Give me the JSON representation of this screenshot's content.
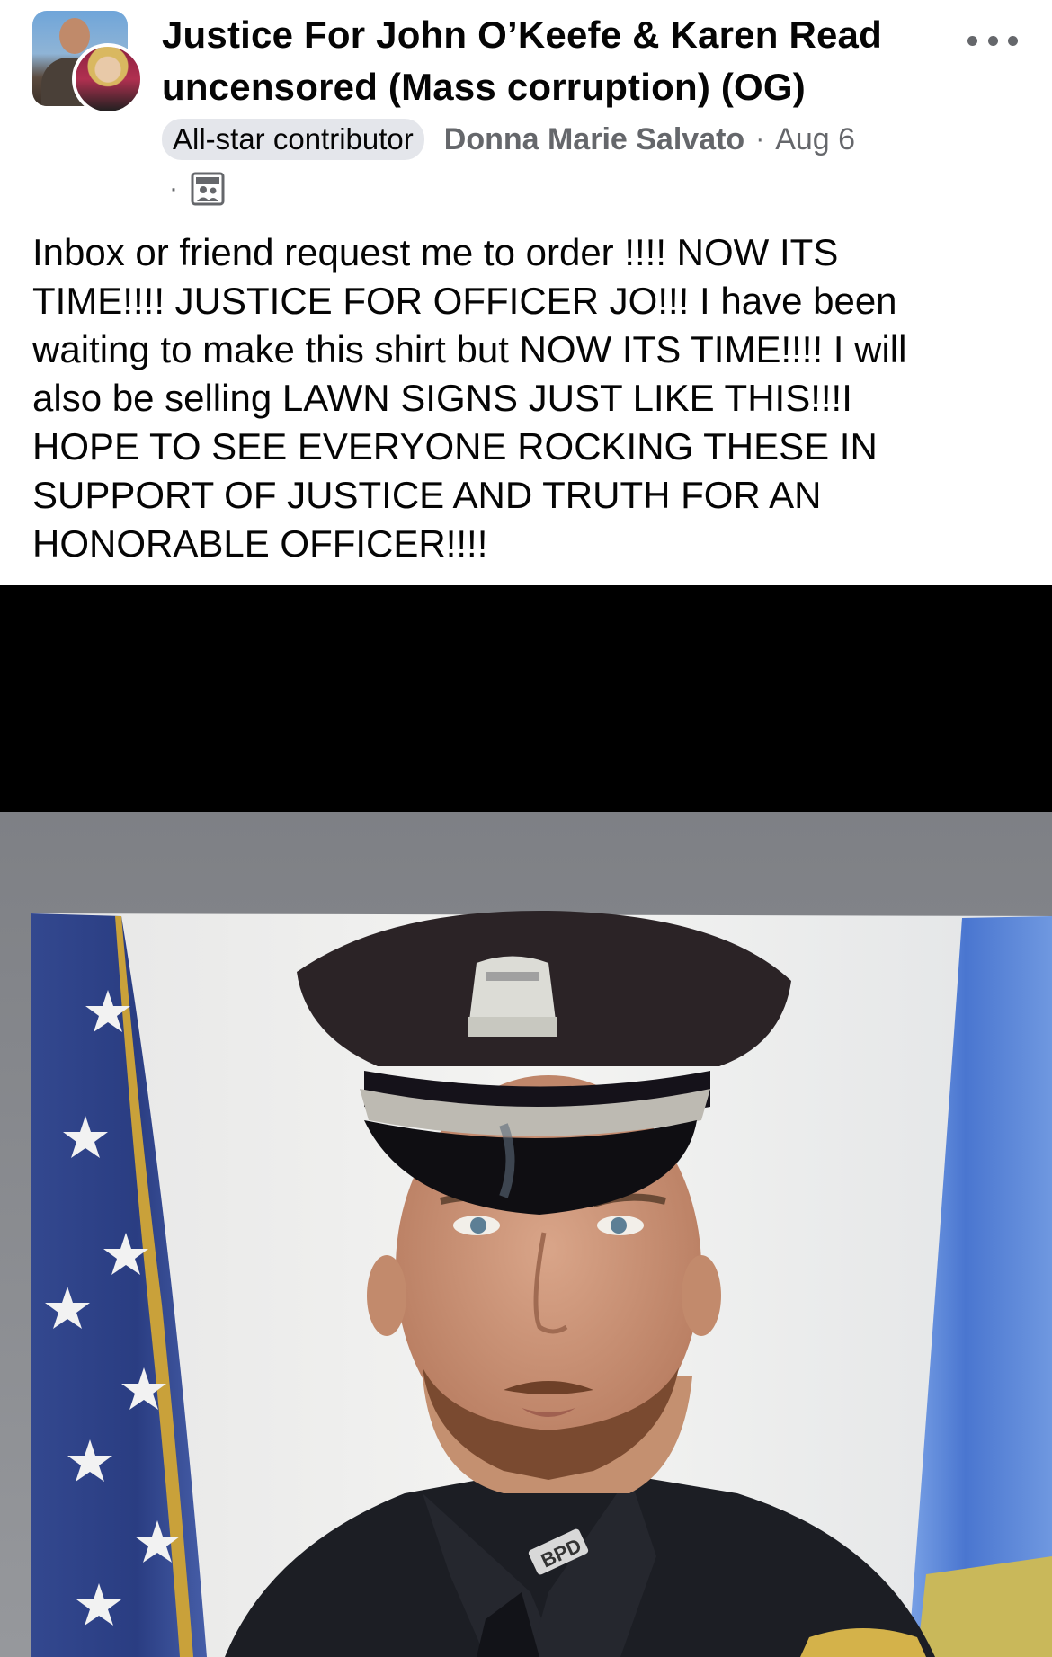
{
  "post": {
    "group_name_line1": "Justice For John O’Keefe & Karen Read",
    "group_name_line2": "uncensored (Mass corruption) (OG)",
    "badge": "All-star contributor",
    "author": "Donna Marie Salvato",
    "separator": "·",
    "date": "Aug 6",
    "dot": "·",
    "privacy_icon": "members-group-icon",
    "text_lines": [
      "Inbox or friend request me to order !!!! NOW ITS",
      "TIME!!!! JUSTICE FOR OFFICER JO!!! I have been",
      "waiting to make this shirt but NOW ITS TIME!!!! I will",
      "also be selling LAWN SIGNS JUST LIKE THIS!!!I",
      "HOPE TO SEE EVERYONE ROCKING THESE IN",
      "SUPPORT OF JUSTICE AND TRUTH FOR AN",
      "HONORABLE OFFICER!!!!"
    ],
    "photo": {
      "subject": "police-officer-portrait",
      "uniform_patch_text": "BPD",
      "colors": {
        "letterbox": "#000000",
        "frame_background": "#8a8c90",
        "flag_blue": "#2c3f8a",
        "state_flag_blue": "#5a86d6",
        "uniform": "#1c1e24"
      }
    }
  },
  "colors": {
    "text_primary": "#050505",
    "text_secondary": "#65676b",
    "badge_bg": "#e4e6eb"
  }
}
